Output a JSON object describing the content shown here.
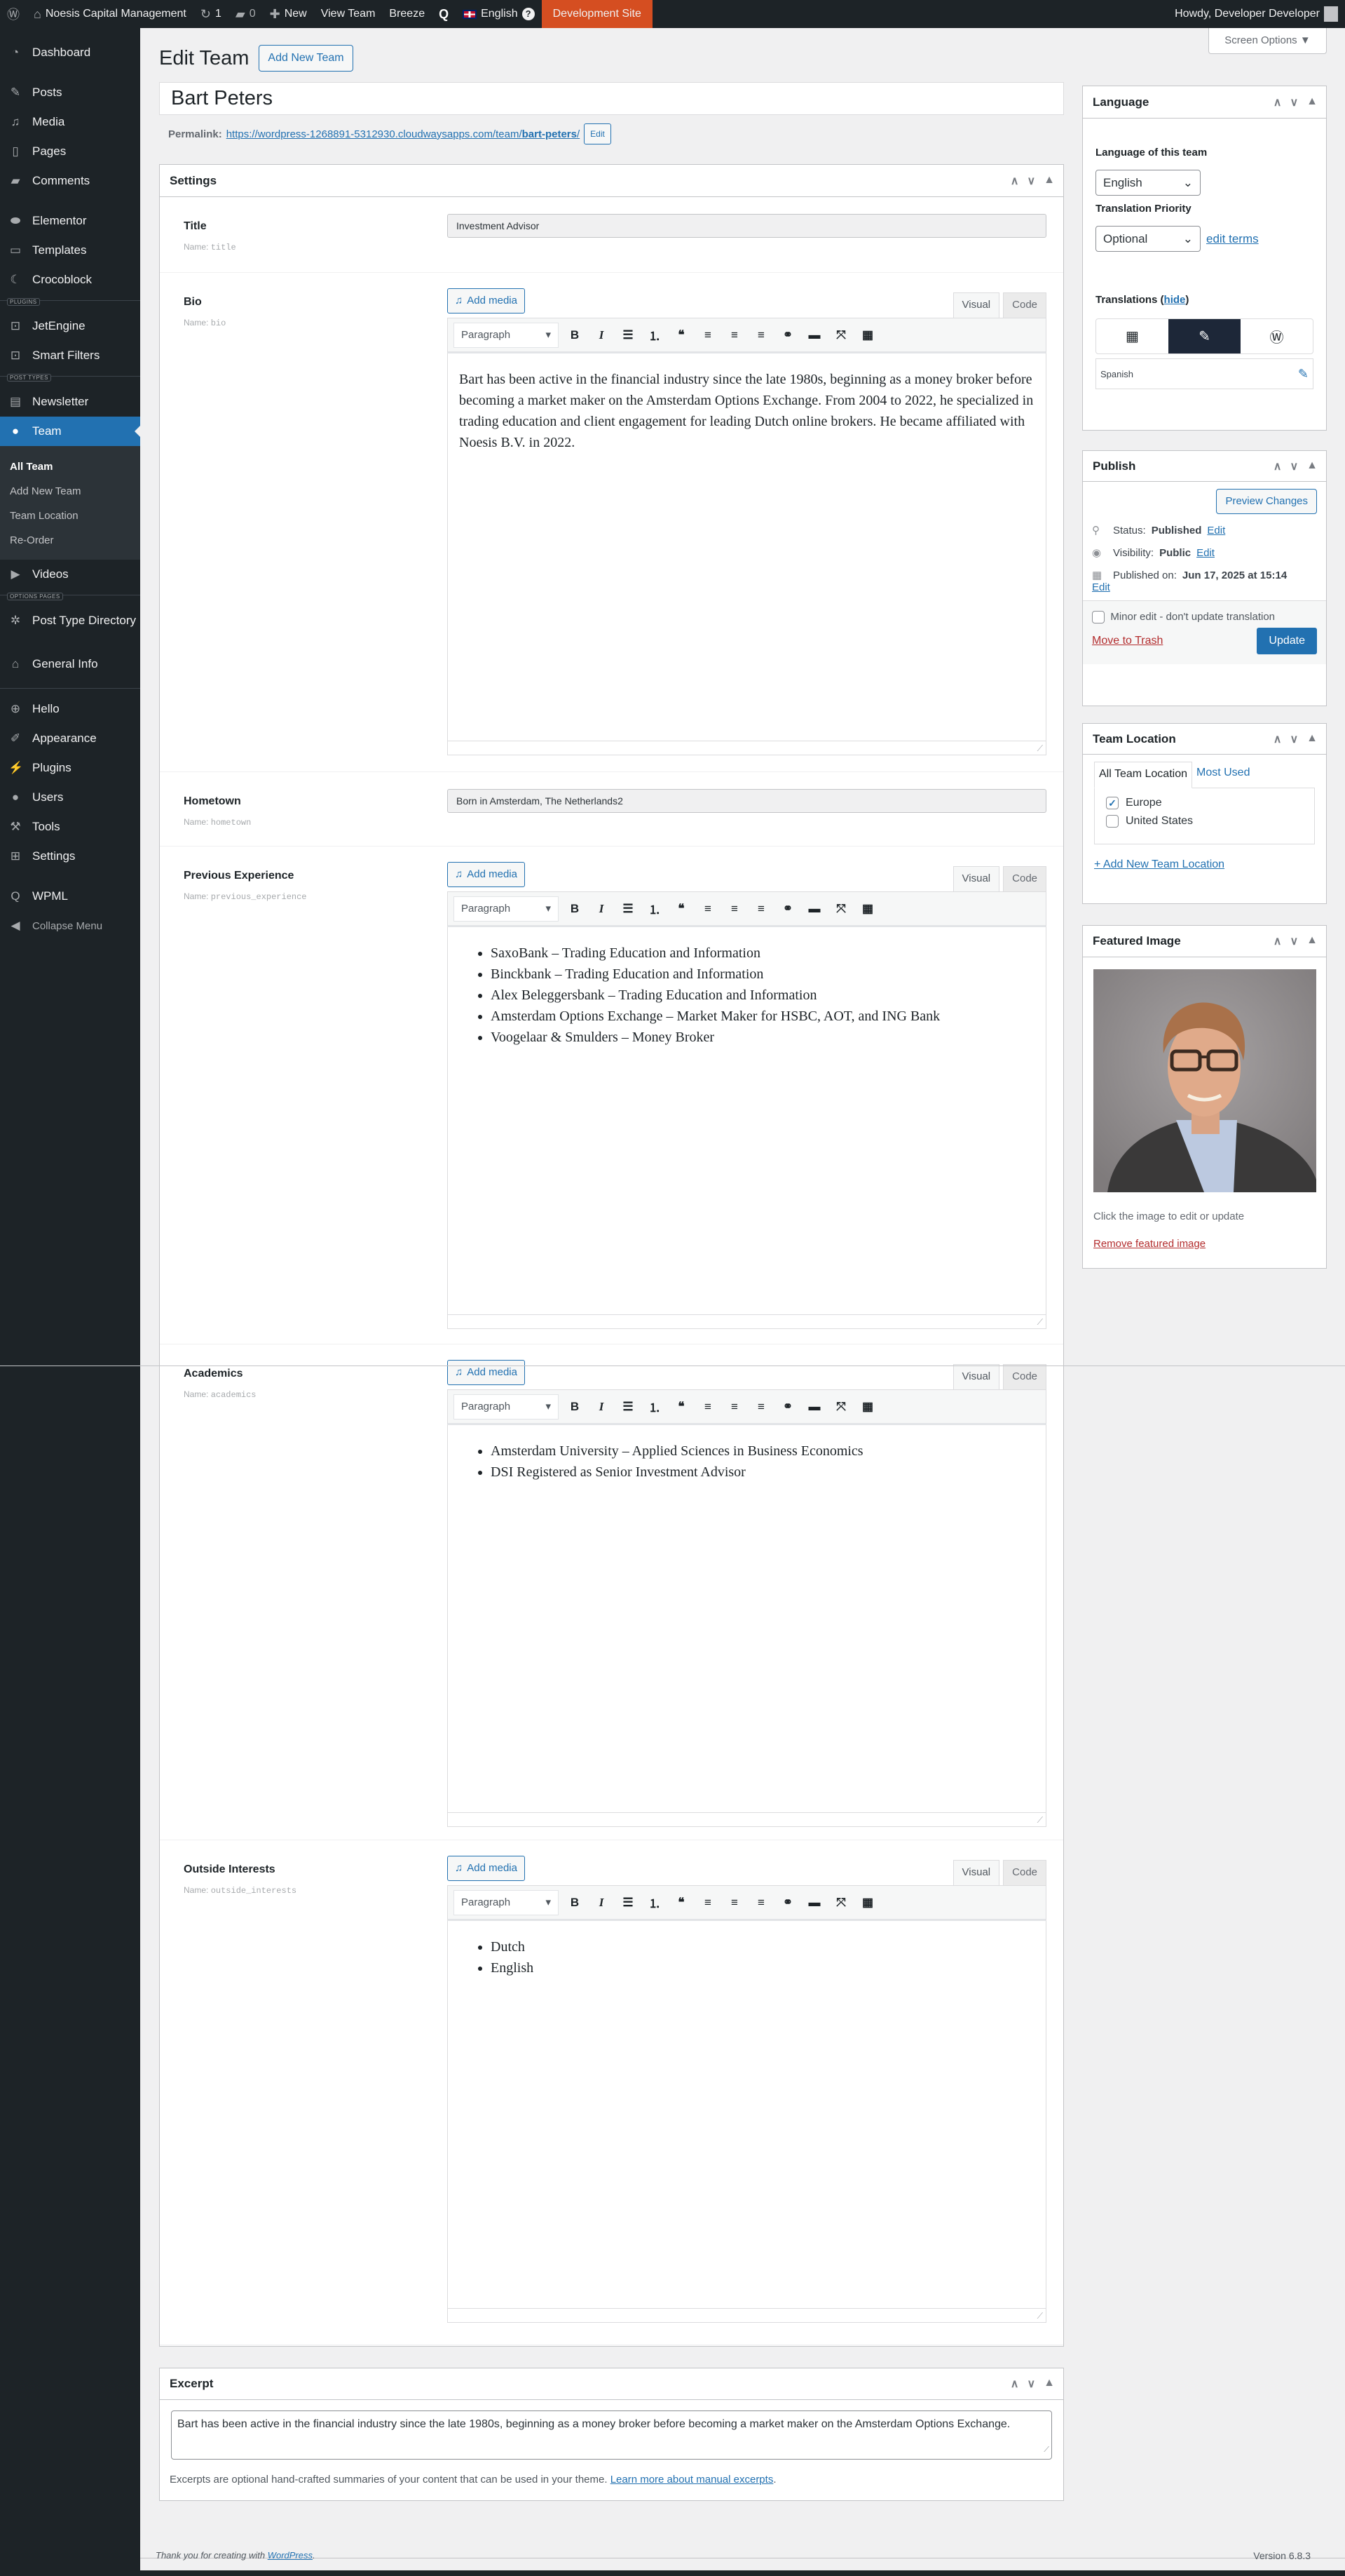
{
  "adminbar": {
    "site_name": "Noesis Capital Management",
    "updates_count": "1",
    "comments_count": "0",
    "new_label": "New",
    "view_label": "View Team",
    "breeze_label": "Breeze",
    "language_label": "English",
    "dev_site_label": "Development Site",
    "greeting": "Howdy, Developer Developer"
  },
  "sidebar": {
    "items": [
      {
        "type": "item",
        "label": "Dashboard",
        "icon": "dashboard-icon",
        "glyph": "◔"
      },
      {
        "type": "gap"
      },
      {
        "type": "item",
        "label": "Posts",
        "icon": "pin-icon",
        "glyph": "✎"
      },
      {
        "type": "item",
        "label": "Media",
        "icon": "media-icon",
        "glyph": "♫"
      },
      {
        "type": "item",
        "label": "Pages",
        "icon": "pages-icon",
        "glyph": "▯"
      },
      {
        "type": "item",
        "label": "Comments",
        "icon": "comment-icon",
        "glyph": "▰"
      },
      {
        "type": "gap"
      },
      {
        "type": "item",
        "label": "Elementor",
        "icon": "elementor-icon",
        "glyph": "⬬"
      },
      {
        "type": "item",
        "label": "Templates",
        "icon": "folder-icon",
        "glyph": "▭"
      },
      {
        "type": "item",
        "label": "Crocoblock",
        "icon": "crocoblock-icon",
        "glyph": "☾"
      },
      {
        "type": "label",
        "label": "PLUGINS"
      },
      {
        "type": "item",
        "label": "JetEngine",
        "icon": "jet-icon",
        "glyph": "⊡"
      },
      {
        "type": "item",
        "label": "Smart Filters",
        "icon": "jet-icon",
        "glyph": "⊡"
      },
      {
        "type": "label",
        "label": "POST TYPES"
      },
      {
        "type": "item",
        "label": "Newsletter",
        "icon": "newsletter-icon",
        "glyph": "▤"
      },
      {
        "type": "item",
        "label": "Team",
        "icon": "user-icon",
        "glyph": "●",
        "current": true,
        "submenu": [
          {
            "label": "All Team",
            "current": true
          },
          {
            "label": "Add New Team"
          },
          {
            "label": "Team Location"
          },
          {
            "label": "Re-Order"
          }
        ]
      },
      {
        "type": "item",
        "label": "Videos",
        "icon": "video-icon",
        "glyph": "▶"
      },
      {
        "type": "label",
        "label": "OPTIONS PAGES"
      },
      {
        "type": "item",
        "label": "Post Type Directory",
        "icon": "gear-icon",
        "glyph": "✲",
        "two": true
      },
      {
        "type": "item",
        "label": "General Info",
        "icon": "home-icon",
        "glyph": "⌂"
      },
      {
        "type": "sep"
      },
      {
        "type": "item",
        "label": "Hello",
        "icon": "plus-circle-icon",
        "glyph": "⊕"
      },
      {
        "type": "item",
        "label": "Appearance",
        "icon": "brush-icon",
        "glyph": "✐"
      },
      {
        "type": "item",
        "label": "Plugins",
        "icon": "plugin-icon",
        "glyph": "⚡"
      },
      {
        "type": "item",
        "label": "Users",
        "icon": "users-icon",
        "glyph": "●"
      },
      {
        "type": "item",
        "label": "Tools",
        "icon": "wrench-icon",
        "glyph": "⚒"
      },
      {
        "type": "item",
        "label": "Settings",
        "icon": "settings-icon",
        "glyph": "⊞"
      },
      {
        "type": "gap"
      },
      {
        "type": "item",
        "label": "WPML",
        "icon": "wpml-icon",
        "glyph": "Q"
      },
      {
        "type": "item",
        "label": "Collapse Menu",
        "icon": "collapse-icon",
        "glyph": "◀",
        "collapse": true
      }
    ]
  },
  "screen_options": "Screen Options ▼",
  "page": {
    "heading": "Edit Team",
    "add_new": "Add New Team",
    "post_title": "Bart Peters",
    "permalink_label": "Permalink:",
    "permalink_base": "https://wordpress-1268891-5312930.cloudwaysapps.com/team/",
    "permalink_slug": "bart-peters",
    "permalink_end": "/",
    "permalink_edit": "Edit"
  },
  "settings": {
    "title": "Settings",
    "name_prefix": "Name:",
    "fields": [
      {
        "label": "Title",
        "name": "title",
        "type": "input",
        "value": "Investment Advisor"
      },
      {
        "label": "Bio",
        "name": "bio",
        "type": "editor",
        "paragraph": "Bart has been active in the financial industry since the late 1980s, beginning as a money broker before becoming a market maker on the Amsterdam Options Exchange. From 2004 to 2022, he specialized in trading education and client engagement for leading Dutch online brokers. He became affiliated with Noesis B.V. in 2022."
      },
      {
        "label": "Hometown",
        "name": "hometown",
        "type": "input",
        "value": "Born in Amsterdam, The Netherlands2"
      },
      {
        "label": "Previous Experience",
        "name": "previous_experience",
        "type": "editor",
        "list": [
          "SaxoBank – Trading Education and Information",
          "Binckbank – Trading Education and Information",
          "Alex Beleggersbank – Trading Education and Information",
          "Amsterdam Options Exchange – Market Maker for HSBC, AOT, and ING Bank",
          "Voogelaar & Smulders – Money Broker"
        ]
      },
      {
        "label": "Academics",
        "name": "academics",
        "type": "editor",
        "list": [
          "Amsterdam University – Applied Sciences in Business Economics",
          "DSI Registered as Senior Investment Advisor"
        ]
      },
      {
        "label": "Outside Interests",
        "name": "outside_interests",
        "type": "editor",
        "list": [
          "Dutch",
          "English"
        ]
      }
    ]
  },
  "editor": {
    "add_media": "Add media",
    "tab_visual": "Visual",
    "tab_code": "Code",
    "format": "Paragraph",
    "tools": [
      {
        "icon": "bold-icon",
        "glyph": "B"
      },
      {
        "icon": "italic-icon",
        "glyph": "I"
      },
      {
        "icon": "bullet-list-icon",
        "glyph": "☰"
      },
      {
        "icon": "numbered-list-icon",
        "glyph": "⒈"
      },
      {
        "icon": "blockquote-icon",
        "glyph": "❝"
      },
      {
        "icon": "align-left-icon",
        "glyph": "≡"
      },
      {
        "icon": "align-center-icon",
        "glyph": "≡"
      },
      {
        "icon": "align-right-icon",
        "glyph": "≡"
      },
      {
        "icon": "link-icon",
        "glyph": "⚭"
      },
      {
        "icon": "read-more-icon",
        "glyph": "▬"
      },
      {
        "icon": "fullscreen-icon",
        "glyph": "⤧"
      },
      {
        "icon": "toolbar-toggle-icon",
        "glyph": "▦"
      }
    ]
  },
  "language_box": {
    "title": "Language",
    "lang_label": "Language of this team",
    "lang_value": "English",
    "priority_label": "Translation Priority",
    "priority_value": "Optional",
    "edit_terms": "edit terms",
    "translations_label": "Translations",
    "hide": "hide",
    "translation_lang": "Spanish"
  },
  "publish": {
    "title": "Publish",
    "preview": "Preview Changes",
    "status_label": "Status:",
    "status_value": "Published",
    "visibility_label": "Visibility:",
    "visibility_value": "Public",
    "published_label": "Published on:",
    "published_value": "Jun 17, 2025 at 15:14",
    "edit": "Edit",
    "minor_edit": "Minor edit - don't update translation",
    "trash": "Move to Trash",
    "update": "Update"
  },
  "team_location": {
    "title": "Team Location",
    "tab_all": "All Team Location",
    "tab_most": "Most Used",
    "terms": [
      {
        "label": "Europe",
        "checked": true
      },
      {
        "label": "United States",
        "checked": false
      }
    ],
    "add_new": "+ Add New Team Location"
  },
  "featured": {
    "title": "Featured Image",
    "hint": "Click the image to edit or update",
    "remove": "Remove featured image"
  },
  "excerpt": {
    "title": "Excerpt",
    "value": "Bart has been active in the financial industry since the late 1980s, beginning as a money broker before becoming a market maker on the Amsterdam Options Exchange.",
    "help": "Excerpts are optional hand-crafted summaries of your content that can be used in your theme.",
    "help_link": "Learn more about manual excerpts",
    "help_end": "."
  },
  "footer": {
    "thanks": "Thank you for creating with",
    "wp_link": "WordPress",
    "thanks_end": ".",
    "version": "Version 6.8.3"
  },
  "colors": {
    "accent": "#2271b1",
    "adminbar": "#1d2327",
    "dev_site": "#d54e21",
    "trash": "#b32d2e"
  }
}
